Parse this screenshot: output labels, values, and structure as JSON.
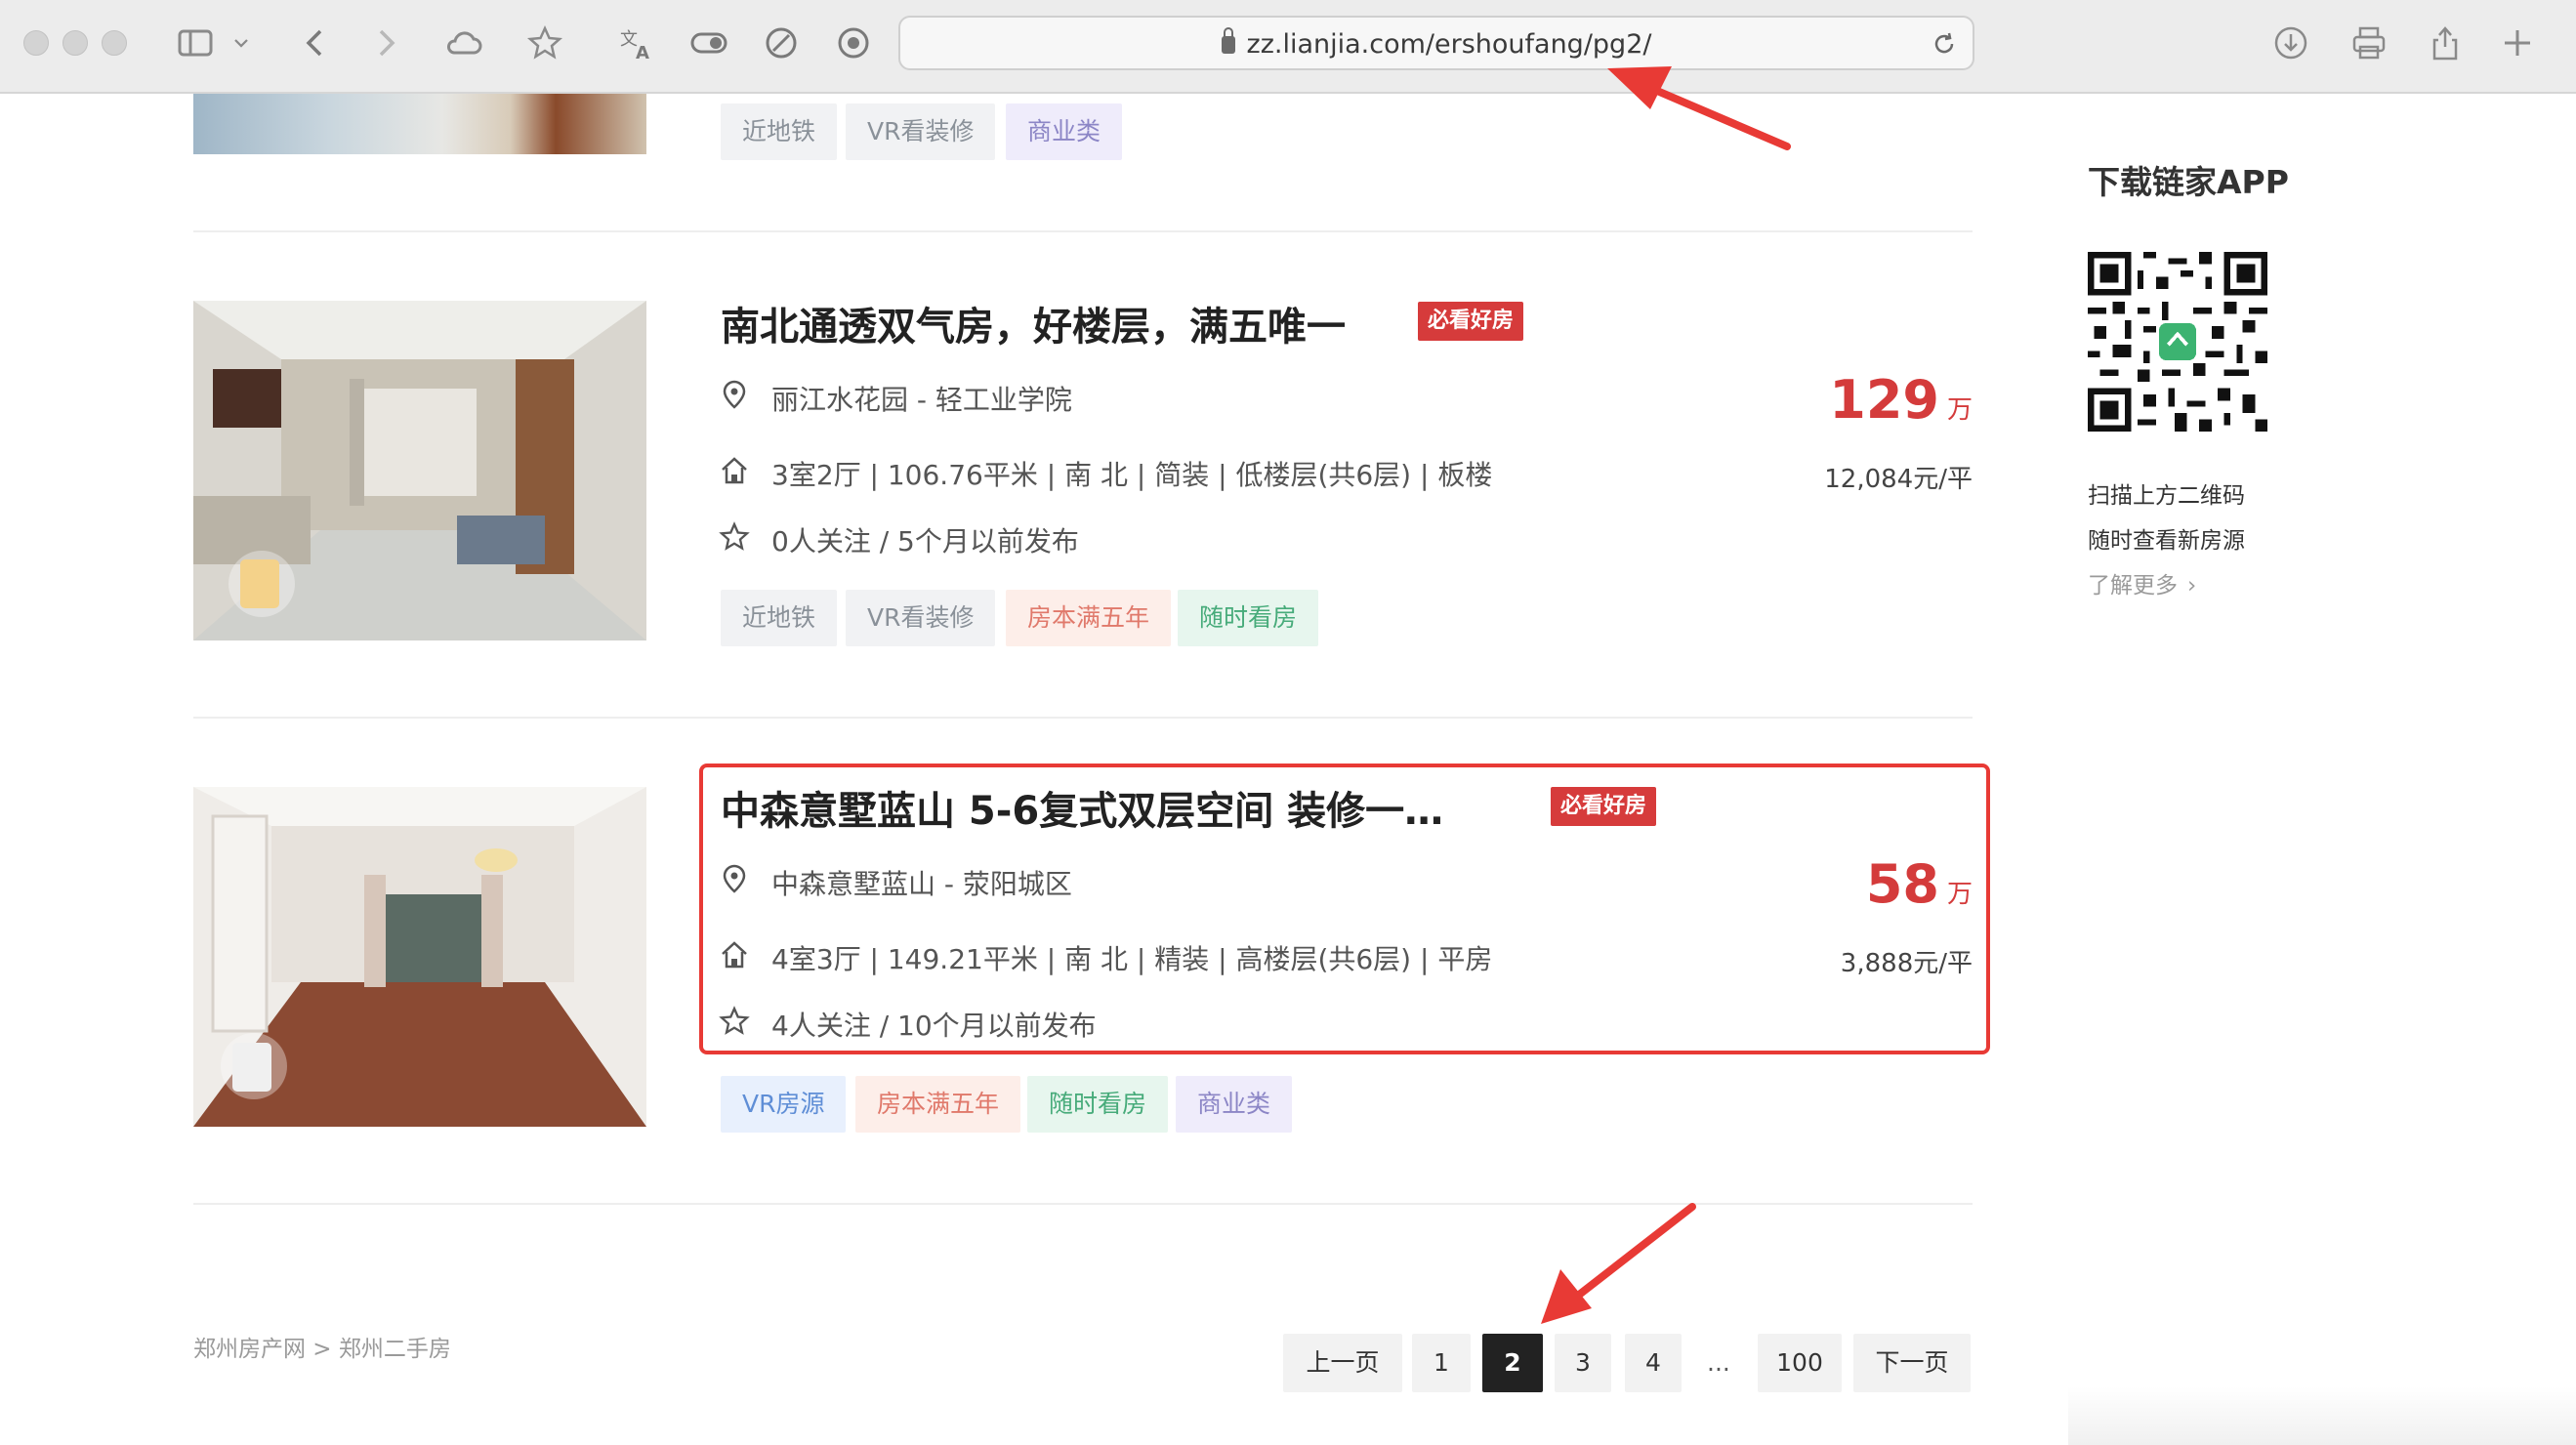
{
  "browser": {
    "url": "zz.lianjia.com/ershoufang/pg2/"
  },
  "listings": [
    {
      "tags": [
        {
          "label": "近地铁",
          "style": "gray"
        },
        {
          "label": "VR看装修",
          "style": "gray"
        },
        {
          "label": "商业类",
          "style": "purple"
        }
      ]
    },
    {
      "title": "南北通透双气房，好楼层，满五唯一",
      "badge": "必看好房",
      "location": "丽江水花园 - 轻工业学院",
      "details": "3室2厅 | 106.76平米 | 南 北 | 简装 | 低楼层(共6层) | 板楼",
      "followers": "0人关注 / 5个月以前发布",
      "price": "129",
      "price_unit": "万",
      "unit_price": "12,084元/平",
      "tags": [
        {
          "label": "近地铁",
          "style": "gray"
        },
        {
          "label": "VR看装修",
          "style": "gray"
        },
        {
          "label": "房本满五年",
          "style": "orange"
        },
        {
          "label": "随时看房",
          "style": "green"
        }
      ]
    },
    {
      "title": "中森意墅蓝山 5-6复式双层空间 装修一…",
      "badge": "必看好房",
      "location": "中森意墅蓝山 - 荥阳城区",
      "details": "4室3厅 | 149.21平米 | 南 北 | 精装 | 高楼层(共6层) | 平房",
      "followers": "4人关注 / 10个月以前发布",
      "price": "58",
      "price_unit": "万",
      "unit_price": "3,888元/平",
      "tags": [
        {
          "label": "VR房源",
          "style": "blue"
        },
        {
          "label": "房本满五年",
          "style": "orange"
        },
        {
          "label": "随时看房",
          "style": "green"
        },
        {
          "label": "商业类",
          "style": "purple"
        }
      ]
    }
  ],
  "sidebar": {
    "title": "下载链家APP",
    "line1": "扫描上方二维码",
    "line2": "随时查看新房源",
    "more": "了解更多"
  },
  "footer": {
    "breadcrumb": "郑州房产网 > 郑州二手房"
  },
  "pagination": {
    "prev": "上一页",
    "pages": [
      "1",
      "2",
      "3",
      "4"
    ],
    "current": "2",
    "ellipsis": "...",
    "last": "100",
    "next": "下一页"
  },
  "colors": {
    "price": "#d43b3b",
    "badge": "#d63b3b",
    "highlight": "#e83a35"
  }
}
